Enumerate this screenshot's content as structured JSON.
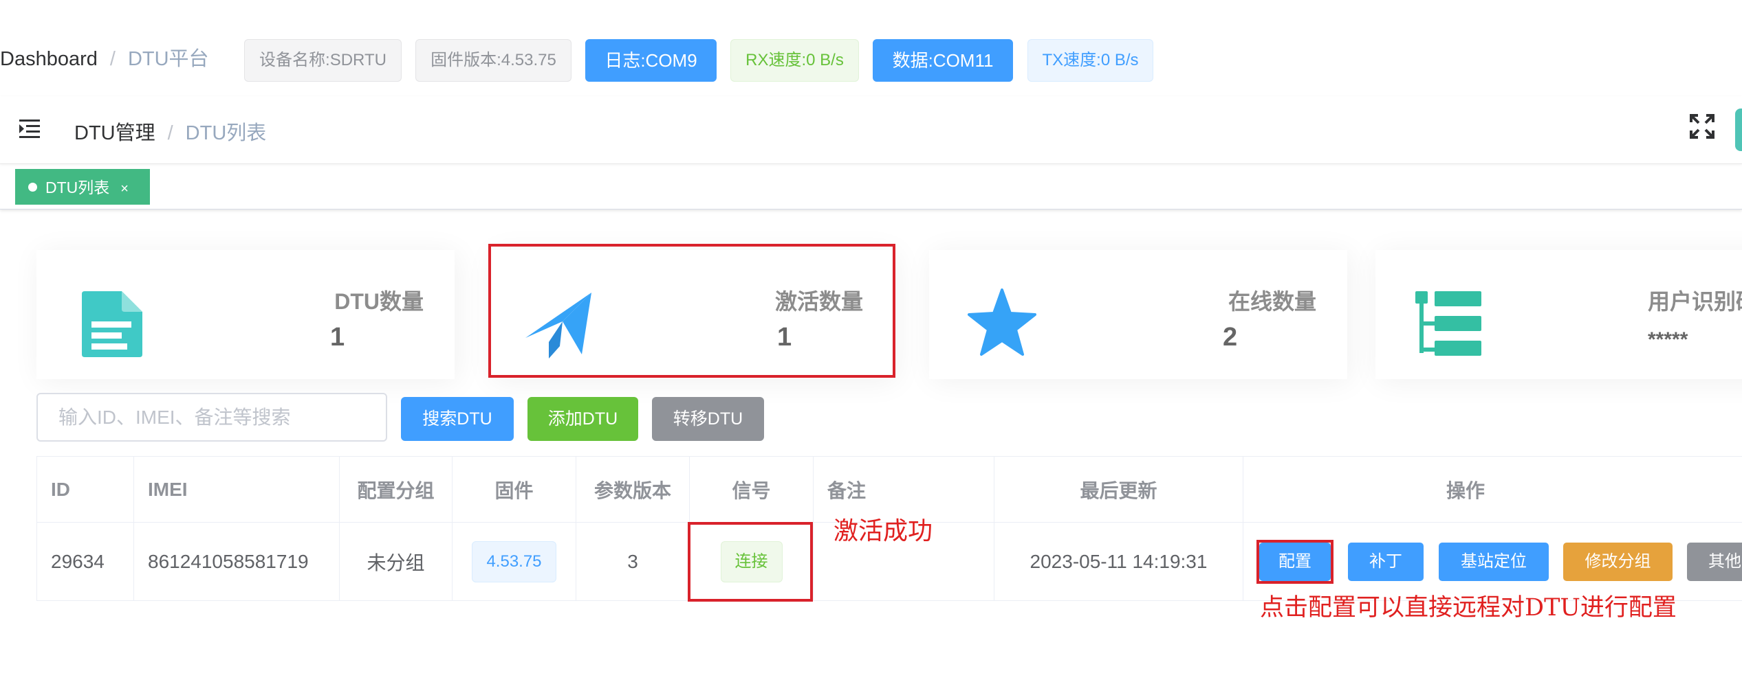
{
  "topbar": {
    "breadcrumb": [
      "Dashboard",
      "DTU平台"
    ],
    "separator": "/",
    "device_name": "设备名称:SDRTU",
    "firmware_version": "固件版本:4.53.75",
    "log_port": "日志:COM9",
    "rx_speed": "RX速度:0 B/s",
    "data_port": "数据:COM11",
    "tx_speed": "TX速度:0 B/s"
  },
  "navbar": {
    "breadcrumb": [
      "DTU管理",
      "DTU列表"
    ],
    "separator": "/",
    "hamburger_icon": "hamburger-icon",
    "fullscreen_icon": "fullscreen-icon"
  },
  "tags_view": {
    "active_tag": "DTU列表",
    "close": "×"
  },
  "stats": [
    {
      "label": "DTU数量",
      "value": "1",
      "icon": "document-icon",
      "color": "#40c9c6"
    },
    {
      "label": "激活数量",
      "value": "1",
      "icon": "paper-plane-icon",
      "color": "#36a3f7"
    },
    {
      "label": "在线数量",
      "value": "2",
      "icon": "star-icon",
      "color": "#36a3f7"
    },
    {
      "label": "用户识别码",
      "value": "*****",
      "icon": "tree-list-icon",
      "color": "#34bfa3"
    }
  ],
  "search": {
    "placeholder": "输入ID、IMEI、备注等搜索",
    "search_button": "搜索DTU",
    "add_button": "添加DTU",
    "transfer_button": "转移DTU"
  },
  "table": {
    "headers": {
      "id": "ID",
      "imei": "IMEI",
      "group": "配置分组",
      "firmware": "固件",
      "param_version": "参数版本",
      "signal": "信号",
      "remark": "备注",
      "last_update": "最后更新",
      "actions": "操作"
    },
    "rows": [
      {
        "id": "29634",
        "imei": "861241058581719",
        "group": "未分组",
        "firmware": "4.53.75",
        "param_version": "3",
        "signal": "连接",
        "remark": "",
        "last_update": "2023-05-11 14:19:31"
      }
    ],
    "action_buttons": {
      "config": "配置",
      "patch": "补丁",
      "locate": "基站定位",
      "change_group": "修改分组",
      "other": "其他"
    }
  },
  "annotations": {
    "activated": "激活成功",
    "config_hint": "点击配置可以直接远程对DTU进行配置"
  },
  "colors": {
    "primary": "#409eff",
    "success": "#67c23a",
    "warning": "#e6a23c",
    "info": "#909399",
    "tag_green": "#42b983",
    "annotation_red": "#d9222b"
  }
}
